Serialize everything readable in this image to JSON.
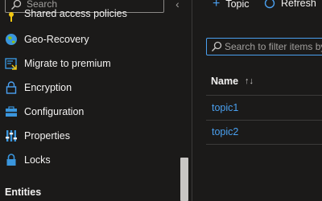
{
  "nav": {
    "search_placeholder": "Search",
    "collapse_glyph": "«",
    "items": [
      {
        "label": "Shared access policies",
        "icon": "key-icon"
      },
      {
        "label": "Geo-Recovery",
        "icon": "globe-icon"
      },
      {
        "label": "Migrate to premium",
        "icon": "migrate-icon"
      },
      {
        "label": "Encryption",
        "icon": "lock-outline-icon"
      },
      {
        "label": "Configuration",
        "icon": "toolbox-icon"
      },
      {
        "label": "Properties",
        "icon": "properties-icon"
      },
      {
        "label": "Locks",
        "icon": "lock-icon"
      }
    ],
    "section_entities": "Entities"
  },
  "main": {
    "commands": {
      "add_topic": "Topic",
      "refresh": "Refresh"
    },
    "filter_placeholder": "Search to filter items by name",
    "table": {
      "column_name": "Name",
      "rows": [
        "topic1",
        "topic2"
      ]
    }
  },
  "colors": {
    "background": "#1b1a19",
    "accent": "#4aa0f0",
    "text": "#f3f2f1",
    "muted": "#a19f9d"
  }
}
